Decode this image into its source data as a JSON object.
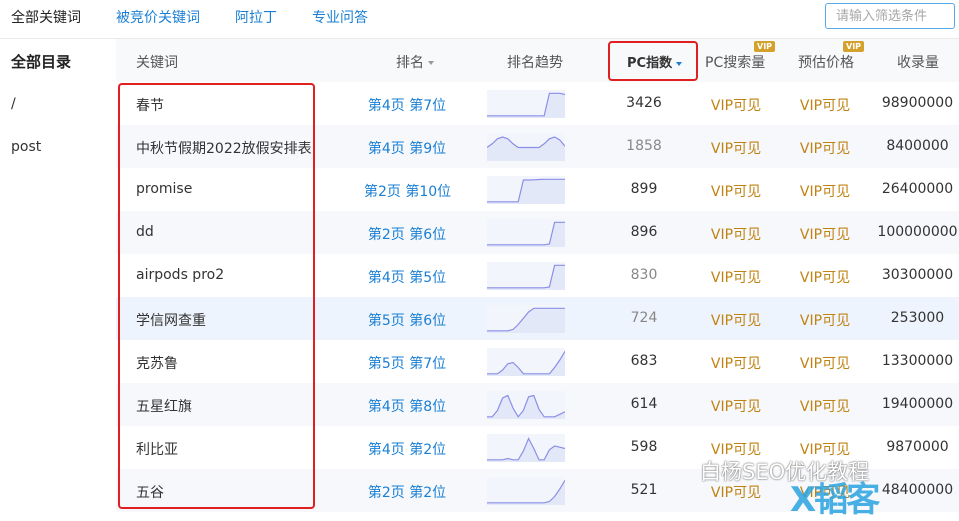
{
  "tabs": [
    "全部关键词",
    "被竞价关键词",
    "阿拉丁",
    "专业问答"
  ],
  "filter_placeholder": "请输入筛选条件",
  "sidebar": {
    "title": "全部目录",
    "items": [
      "/",
      "post"
    ]
  },
  "headers": {
    "keyword": "关键词",
    "rank": "排名",
    "trend": "排名趋势",
    "pc_index": "PC指数",
    "pc_search": "PC搜索量",
    "price": "预估价格",
    "indexed": "收录量",
    "vip_badge": "VIP"
  },
  "rows": [
    {
      "keyword": "春节",
      "rank": "第4页 第7位",
      "pc": "3426",
      "pc_search": "VIP可见",
      "price": "VIP可见",
      "indexed": "98900000",
      "trend": [
        0.05,
        0.05,
        0.05,
        0.05,
        0.05,
        0.05,
        0.05,
        0.05,
        0.05,
        0.05,
        0.05,
        0.05,
        0.95,
        0.95,
        0.95,
        0.9
      ]
    },
    {
      "keyword": "中秋节假期2022放假安排表",
      "rank": "第4页 第9位",
      "pc": "1858",
      "pc_search": "VIP可见",
      "price": "VIP可见",
      "indexed": "8400000",
      "trend": [
        0.5,
        0.65,
        0.85,
        0.92,
        0.85,
        0.65,
        0.5,
        0.5,
        0.5,
        0.5,
        0.5,
        0.65,
        0.85,
        0.92,
        0.8,
        0.55
      ]
    },
    {
      "keyword": "promise",
      "rank": "第2页 第10位",
      "pc": "899",
      "pc_search": "VIP可见",
      "price": "VIP可见",
      "indexed": "26400000",
      "trend": [
        0.05,
        0.05,
        0.05,
        0.05,
        0.05,
        0.05,
        0.05,
        0.92,
        0.92,
        0.93,
        0.94,
        0.95,
        0.95,
        0.95,
        0.95,
        0.95
      ]
    },
    {
      "keyword": "dd",
      "rank": "第2页 第6位",
      "pc": "896",
      "pc_search": "VIP可见",
      "price": "VIP可见",
      "indexed": "100000000",
      "trend": [
        0.05,
        0.05,
        0.05,
        0.05,
        0.05,
        0.05,
        0.05,
        0.05,
        0.05,
        0.05,
        0.05,
        0.05,
        0.08,
        0.95,
        0.95,
        0.95
      ]
    },
    {
      "keyword": "airpods pro2",
      "rank": "第4页 第5位",
      "pc": "830",
      "pc_search": "VIP可见",
      "price": "VIP可见",
      "indexed": "30300000",
      "trend": [
        0.05,
        0.05,
        0.05,
        0.05,
        0.05,
        0.05,
        0.05,
        0.05,
        0.05,
        0.05,
        0.05,
        0.05,
        0.08,
        0.95,
        0.95,
        0.95
      ]
    },
    {
      "keyword": "学信网查重",
      "rank": "第5页 第6位",
      "pc": "724",
      "pc_search": "VIP可见",
      "price": "VIP可见",
      "indexed": "253000",
      "trend": [
        0.05,
        0.05,
        0.05,
        0.05,
        0.05,
        0.1,
        0.3,
        0.55,
        0.8,
        0.95,
        0.95,
        0.95,
        0.95,
        0.95,
        0.95,
        0.95
      ]
    },
    {
      "keyword": "克苏鲁",
      "rank": "第5页 第7位",
      "pc": "683",
      "pc_search": "VIP可见",
      "price": "VIP可见",
      "indexed": "13300000",
      "trend": [
        0.05,
        0.05,
        0.05,
        0.2,
        0.45,
        0.5,
        0.3,
        0.05,
        0.05,
        0.05,
        0.05,
        0.05,
        0.05,
        0.3,
        0.6,
        0.95
      ]
    },
    {
      "keyword": "五星红旗",
      "rank": "第4页 第8位",
      "pc": "614",
      "pc_search": "VIP可见",
      "price": "VIP可见",
      "indexed": "19400000",
      "trend": [
        0.05,
        0.05,
        0.3,
        0.8,
        0.9,
        0.4,
        0.05,
        0.3,
        0.85,
        0.9,
        0.35,
        0.05,
        0.05,
        0.05,
        0.15,
        0.25
      ]
    },
    {
      "keyword": "利比亚",
      "rank": "第4页 第2位",
      "pc": "598",
      "pc_search": "VIP可见",
      "price": "VIP可见",
      "indexed": "9870000",
      "trend": [
        0.05,
        0.05,
        0.05,
        0.05,
        0.1,
        0.05,
        0.05,
        0.4,
        0.9,
        0.5,
        0.05,
        0.05,
        0.45,
        0.6,
        0.55,
        0.5
      ]
    },
    {
      "keyword": "五谷",
      "rank": "第2页 第2位",
      "pc": "521",
      "pc_search": "VIP可见",
      "price": "VIP可见",
      "indexed": "48400000",
      "trend": [
        0.05,
        0.05,
        0.05,
        0.05,
        0.05,
        0.05,
        0.05,
        0.05,
        0.05,
        0.05,
        0.05,
        0.05,
        0.1,
        0.3,
        0.6,
        0.95
      ]
    }
  ],
  "watermark": "白杨SEO优化教程",
  "watermark_logo": "X韬客",
  "colors": {
    "link": "#1a7fd4",
    "vip": "#c08312",
    "trend_line": "#8b8fe6",
    "trend_fill": "#e3e8f9",
    "highlight": "#e02020"
  }
}
